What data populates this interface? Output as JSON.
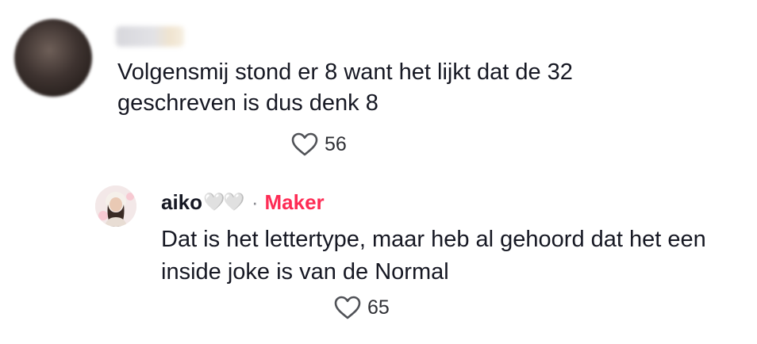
{
  "comments": [
    {
      "text": "Volgensmij stond er 8 want het lijkt dat de 32 geschreven is dus denk 8",
      "like_count": "56"
    }
  ],
  "reply": {
    "username": "aiko",
    "username_emoji": "🤍🤍",
    "separator": "·",
    "badge": "Maker",
    "text": "Dat is het lettertype, maar heb al gehoord dat het een inside joke is van de Normal",
    "like_count": "65"
  },
  "colors": {
    "text": "#161823",
    "creator_badge": "#fe2c55",
    "muted": "#8a8b91"
  },
  "icons": {
    "like": "heart-outline-icon"
  }
}
